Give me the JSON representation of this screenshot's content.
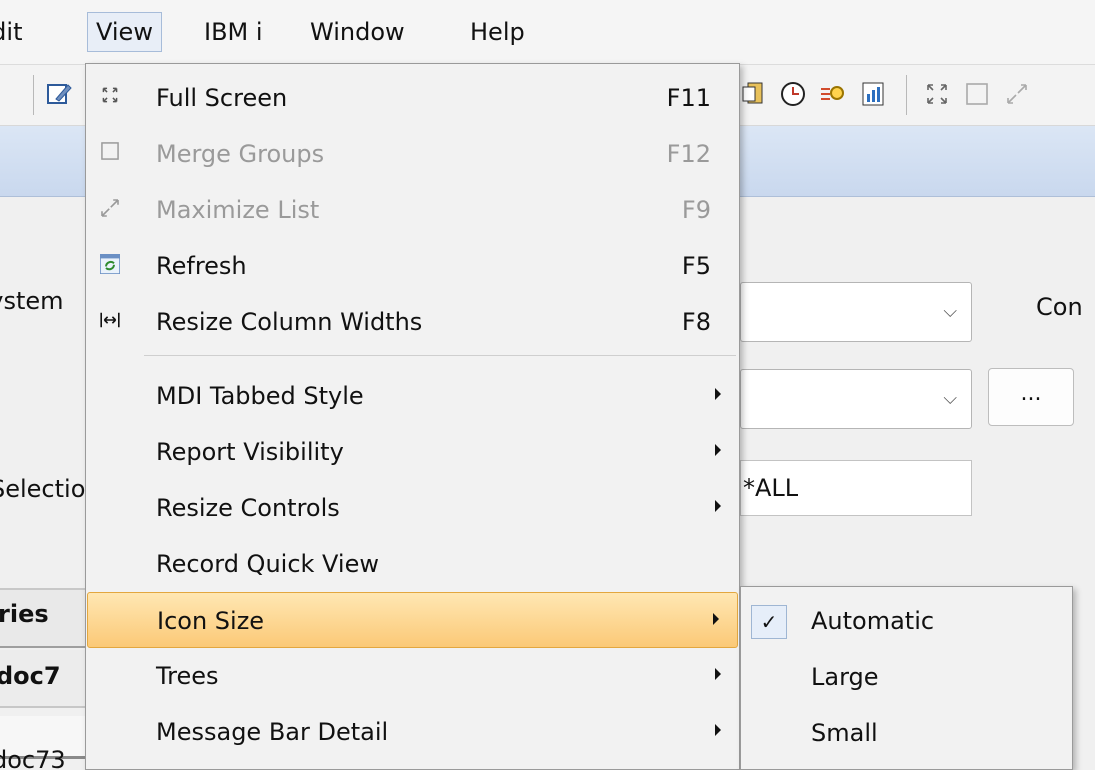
{
  "menubar": {
    "items": [
      {
        "label": "Edit"
      },
      {
        "label": "View"
      },
      {
        "label": "IBM i"
      },
      {
        "label": "Window"
      },
      {
        "label": "Help"
      }
    ]
  },
  "form": {
    "system_label": "System",
    "con_label": "Con",
    "selection_label": "Selection",
    "selection_value": "*ALL",
    "browse_label": "...",
    "tab_label": "ries",
    "row1": "doc7",
    "row2": "doc73"
  },
  "view_menu": {
    "items": [
      {
        "label": "Full Screen",
        "accel": "F11",
        "icon": "full-screen-icon",
        "enabled": true
      },
      {
        "label": "Merge Groups",
        "accel": "F12",
        "icon": "merge-groups-icon",
        "enabled": false
      },
      {
        "label": "Maximize List",
        "accel": "F9",
        "icon": "maximize-list-icon",
        "enabled": false
      },
      {
        "label": "Refresh",
        "accel": "F5",
        "icon": "refresh-icon",
        "enabled": true
      },
      {
        "label": "Resize Column Widths",
        "accel": "F8",
        "icon": "resize-columns-icon",
        "enabled": true
      },
      {
        "label": "MDI Tabbed Style",
        "submenu": true
      },
      {
        "label": "Report Visibility",
        "submenu": true
      },
      {
        "label": "Resize Controls",
        "submenu": true
      },
      {
        "label": "Record Quick View",
        "submenu": false
      },
      {
        "label": "Icon Size",
        "submenu": true,
        "highlighted": true
      },
      {
        "label": "Trees",
        "submenu": true
      },
      {
        "label": "Message Bar Detail",
        "submenu": true
      }
    ]
  },
  "icon_size_submenu": {
    "items": [
      {
        "label": "Automatic",
        "checked": true
      },
      {
        "label": "Large",
        "checked": false
      },
      {
        "label": "Small",
        "checked": false
      }
    ],
    "check_glyph": "✓"
  },
  "colors": {
    "highlight": "#fbc977",
    "band": "#c9d8ee"
  }
}
